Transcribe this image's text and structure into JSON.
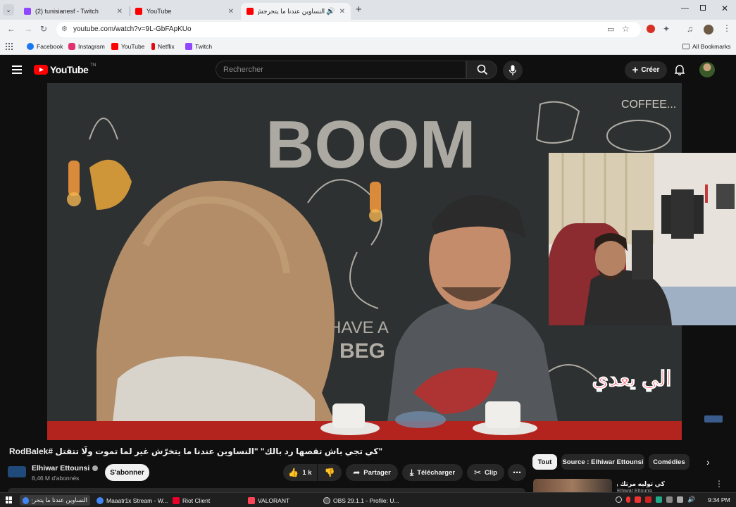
{
  "browser": {
    "tabs": [
      {
        "label": "(2) tunisianesf - Twitch",
        "favicon_color": "#9146ff",
        "active": false
      },
      {
        "label": "YouTube",
        "favicon_color": "#ff0000",
        "active": false
      },
      {
        "label": "النساوين عندنا ما يتحرجش غ",
        "favicon_color": "#ff0000",
        "active": true
      }
    ],
    "new_tab": "+",
    "url": "youtube.com/watch?v=9L-GbFApKUo",
    "bookmarks": [
      {
        "label": "Facebook",
        "color": "#1877f2"
      },
      {
        "label": "Instagram",
        "color": "#e1306c"
      },
      {
        "label": "YouTube",
        "color": "#ff0000"
      },
      {
        "label": "Netflix",
        "color": "#e50914"
      },
      {
        "label": "Twitch",
        "color": "#9146ff"
      }
    ],
    "all_bookmarks": "All Bookmarks"
  },
  "youtube": {
    "logo_text": "YouTube",
    "logo_suffix": "TN",
    "search_placeholder": "Rechercher",
    "create_label": "Créer",
    "video_title": "\"كي تجي باش تقصها رد بالك\" \"النساوين عندنا ما يتخرّش غير لما تموت ولّا تتقتل #RodBalek",
    "title_hashtag": "#RodBalek",
    "channel_name": "Elhiwar Ettounsi",
    "subscribers": "8,46 M d'abonnés",
    "subscribe_label": "S'abonner",
    "like_count": "1 k",
    "share_label": "Partager",
    "download_label": "Télécharger",
    "clip_label": "Clip",
    "chips": [
      "Tout",
      "Source : Elhiwar Ettounsi",
      "Comédies"
    ],
    "recommended_title": "كي توليه مرتك رد بالك",
    "recommended_channel": "Elhiwar Ettounsi",
    "overlay_text": "الي يعدي",
    "board_text_1": "BOOM",
    "board_text_2": "COFFEE...",
    "board_text_3": "HAVE A",
    "board_text_4": "BEG"
  },
  "taskbar": {
    "items": [
      {
        "label": "النساوين عندنا ما يتخرج...",
        "color": "#4285f4"
      },
      {
        "label": "Maaatr1x Stream - W...",
        "color": "#4285f4"
      },
      {
        "label": "Riot Client",
        "color": "#eb0029"
      },
      {
        "label": "VALORANT",
        "color": "#fd4556"
      },
      {
        "label": "OBS 29.1.1 - Profile: U...",
        "color": "#302e31"
      }
    ],
    "time": "9:34 PM"
  },
  "colors": {
    "accent": "#ff0000",
    "tabbar_bg": "#dfe3e8",
    "yt_bg": "#0f0f0f"
  }
}
